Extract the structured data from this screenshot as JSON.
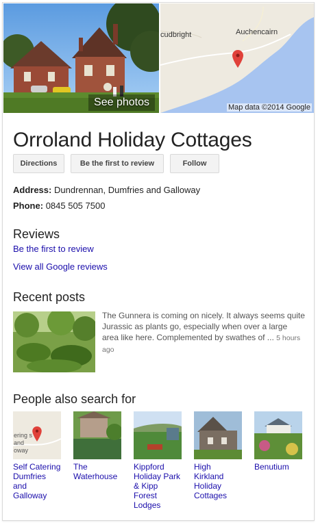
{
  "photo": {
    "see_photos_label": "See photos"
  },
  "map": {
    "labels": [
      "cudbright",
      "Auchencairn"
    ],
    "credit": "Map data ©2014 Google",
    "colors": {
      "water": "#a7c4f0",
      "land": "#eeeae0",
      "road": "#ffffff",
      "pin": "#e0413a"
    }
  },
  "business": {
    "title": "Orroland Holiday Cottages",
    "address_label": "Address:",
    "address_value": "Dundrennan, Dumfries and Galloway",
    "phone_label": "Phone:",
    "phone_value": "0845 505 7500"
  },
  "actions": {
    "directions": "Directions",
    "review": "Be the first to review",
    "follow": "Follow"
  },
  "reviews": {
    "heading": "Reviews",
    "first_review_link": "Be the first to review",
    "view_all_link": "View all Google reviews"
  },
  "posts": {
    "heading": "Recent posts",
    "text": "The Gunnera is coming on nicely. It always seems quite Jurassic as plants go, especially when over a large area like here. Complemented by swathes of ...",
    "time": "5 hours ago"
  },
  "also_search": {
    "heading": "People also search for",
    "items": [
      {
        "label": "Self Catering Dumfries and Galloway",
        "map_text": "ering s and oway"
      },
      {
        "label": "The Waterhouse"
      },
      {
        "label": "Kippford Holiday Park & Kipp Forest Lodges"
      },
      {
        "label": "High Kirkland Holiday Cottages"
      },
      {
        "label": "Benutium"
      }
    ]
  },
  "colors": {
    "link": "#1a0dab",
    "text": "#222222",
    "muted": "#545454"
  }
}
